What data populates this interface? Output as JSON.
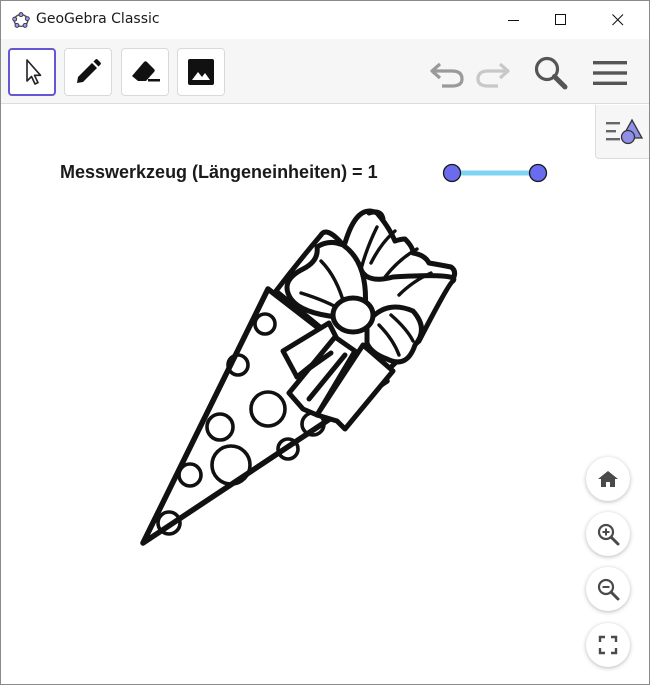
{
  "window": {
    "title": "GeoGebra Classic"
  },
  "toolbar": {
    "tools": [
      {
        "name": "move",
        "icon": "cursor-arrow-icon",
        "selected": true
      },
      {
        "name": "pen",
        "icon": "pen-icon",
        "selected": false
      },
      {
        "name": "eraser",
        "icon": "eraser-icon",
        "selected": false
      },
      {
        "name": "image",
        "icon": "image-icon",
        "selected": false
      }
    ],
    "right_icons": [
      "undo-icon",
      "redo-icon",
      "search-icon",
      "menu-icon"
    ]
  },
  "graphics": {
    "slider": {
      "label": "Messwerkzeug (Längeneinheiten) = 1",
      "value": 1
    },
    "algebra_toggle_icon": "algebra-view-icon",
    "nav_icons": [
      "home-icon",
      "zoom-in-icon",
      "zoom-out-icon",
      "fullscreen-icon"
    ]
  },
  "colors": {
    "selected_tool_border": "#6557d2",
    "slider_track": "#7fd4f2",
    "slider_point": "#6b6bf0"
  }
}
